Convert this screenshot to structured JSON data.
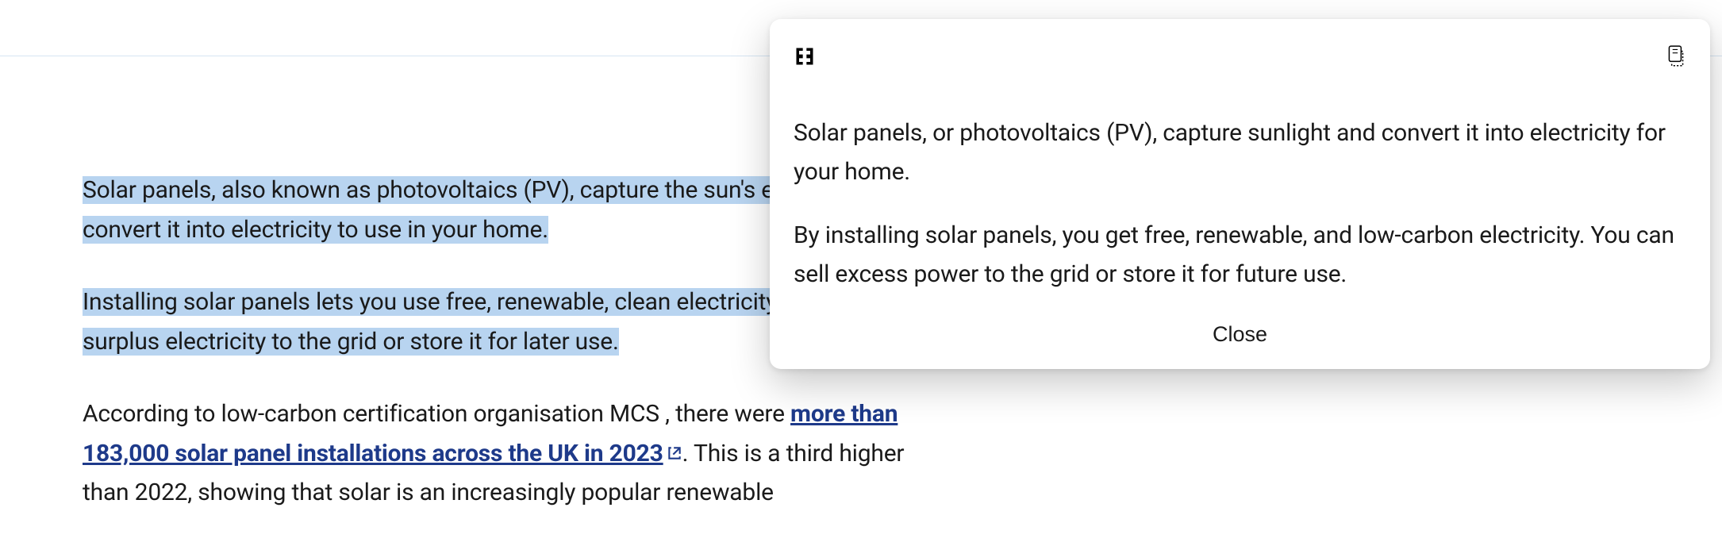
{
  "article": {
    "paragraph1_highlighted": "Solar panels, also known as photovoltaics (PV), capture the sun's energy and convert it into electricity to use in your home.",
    "paragraph2_highlighted": "Installing solar panels lets you use free, renewable, clean electricity. You can sell surplus electricity to the grid or store it for later use.",
    "paragraph3_prefix": "According to low-carbon certification organisation MCS , there were ",
    "paragraph3_link": "more than 183,000 solar panel installations across the UK in 2023",
    "paragraph3_suffix": ". This is a third higher than 2022, showing that solar is an increasingly popular renewable"
  },
  "popup": {
    "summary1": "Solar panels, or photovoltaics (PV), capture sunlight and convert it into electricity for your home.",
    "summary2": "By installing solar panels, you get free, renewable, and low-carbon electricity. You can sell excess power to the grid or store it for future use.",
    "close_label": "Close"
  }
}
